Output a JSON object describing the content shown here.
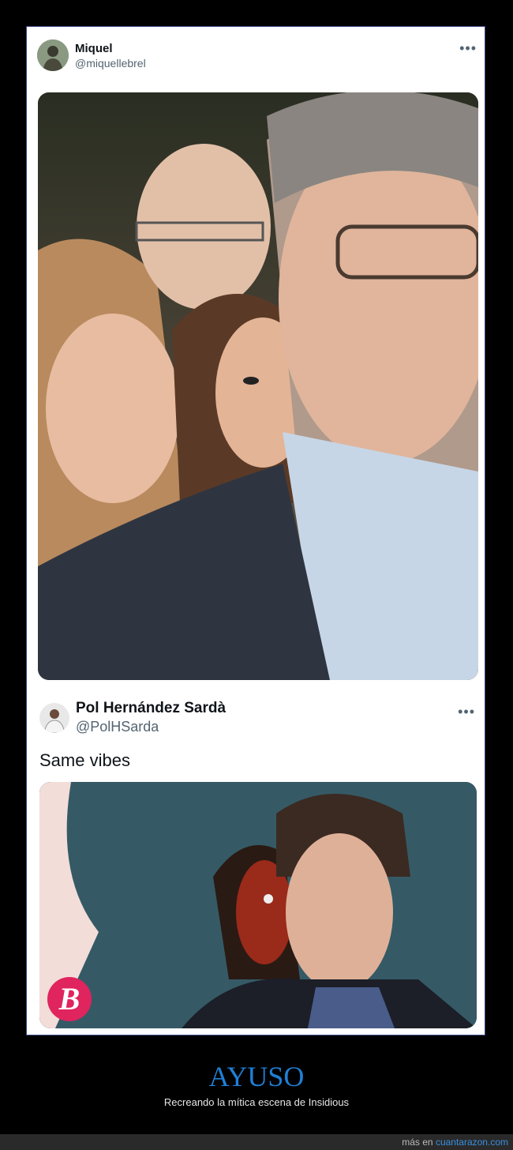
{
  "tweet1": {
    "name": "Miquel",
    "handle": "@miquellebrel",
    "more_icon": "more-horizontal-icon",
    "image_description": "Two men and two women at an event; a woman in the back stares over a man's shoulder"
  },
  "tweet2": {
    "name": "Pol Hernández Sardà",
    "handle": "@PolHSarda",
    "text": "Same vibes",
    "more_icon": "more-horizontal-icon",
    "app_badge_letter": "B"
  },
  "caption": {
    "title": "AYUSO",
    "subtitle": "Recreando la mítica escena de Insidious"
  },
  "footer": {
    "prefix": "más en",
    "link": "cuantarazon.com"
  },
  "colors": {
    "title": "#1f7fd6",
    "link": "#3a8fe0",
    "badge": "#e0245e"
  }
}
